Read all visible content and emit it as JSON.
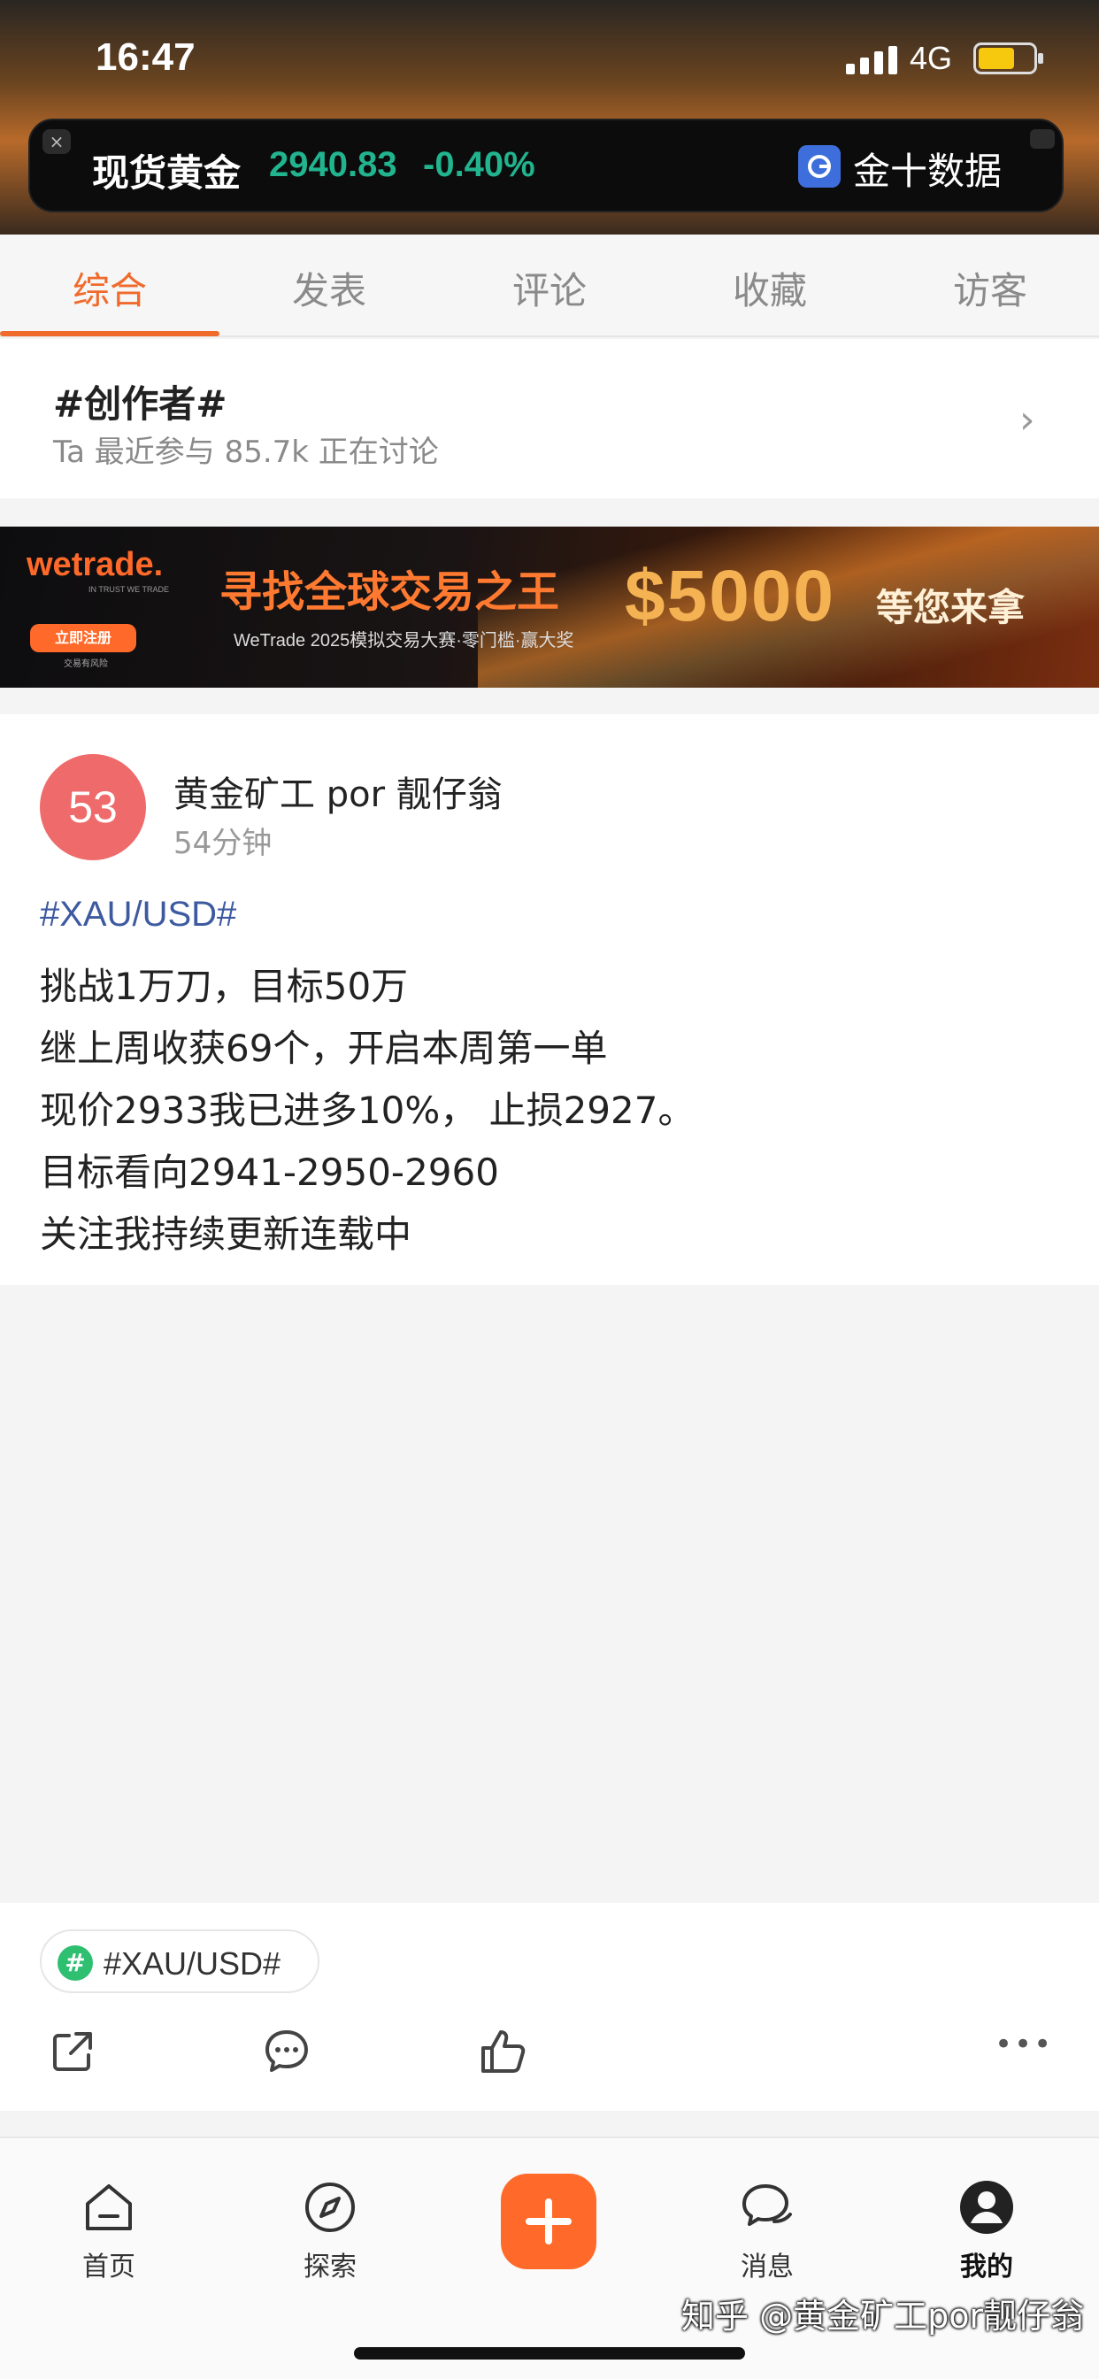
{
  "status_bar": {
    "time": "16:47",
    "network": "4G"
  },
  "ticker": {
    "name": "现货黄金",
    "price": "2940.83",
    "change": "-0.40%",
    "brand": "金十数据",
    "close_glyph": "×",
    "colors": {
      "price": "#21b48f",
      "background": "#0c0c0c"
    }
  },
  "tabs": [
    {
      "label": "综合",
      "active": true
    },
    {
      "label": "发表",
      "active": false
    },
    {
      "label": "评论",
      "active": false
    },
    {
      "label": "收藏",
      "active": false
    },
    {
      "label": "访客",
      "active": false
    }
  ],
  "topic": {
    "title": "#创作者#",
    "meta": "Ta 最近参与   85.7k 正在讨论",
    "chevron": "›"
  },
  "banner": {
    "brand": "wetrade.",
    "brand_sub": "IN TRUST WE TRADE",
    "button": "立即注册",
    "risk": "交易有风险",
    "headline": "寻找全球交易之王",
    "sub": "WeTrade 2025模拟交易大赛·零门槛·赢大奖",
    "money": "$5000",
    "tail": "等您来拿"
  },
  "post": {
    "avatar_text": "53",
    "author": "黄金矿工 por 靓仔翁",
    "time": "54分钟",
    "hashtag": "#XAU/USD#",
    "lines": [
      "挑战1万刀，目标50万",
      "继上周收获69个，开启本周第一单",
      "现价2933我已进多10%， 止损2927。",
      "目标看向2941-2950-2960",
      "关注我持续更新连载中"
    ]
  },
  "tag_chip": {
    "icon": "#",
    "label": "#XAU/USD#"
  },
  "actions": {
    "more": "•••"
  },
  "nav": [
    {
      "label": "首页",
      "icon": "home-icon"
    },
    {
      "label": "探索",
      "icon": "compass-icon"
    },
    {
      "label": "",
      "icon": "plus-icon"
    },
    {
      "label": "消息",
      "icon": "chat-icon"
    },
    {
      "label": "我的",
      "icon": "user-icon"
    }
  ],
  "watermark": "知乎 @黄金矿工por靓仔翁",
  "colors": {
    "accent": "#f06a2b",
    "hashtag": "#3d5aa0",
    "avatar": "#ef6a6a"
  }
}
